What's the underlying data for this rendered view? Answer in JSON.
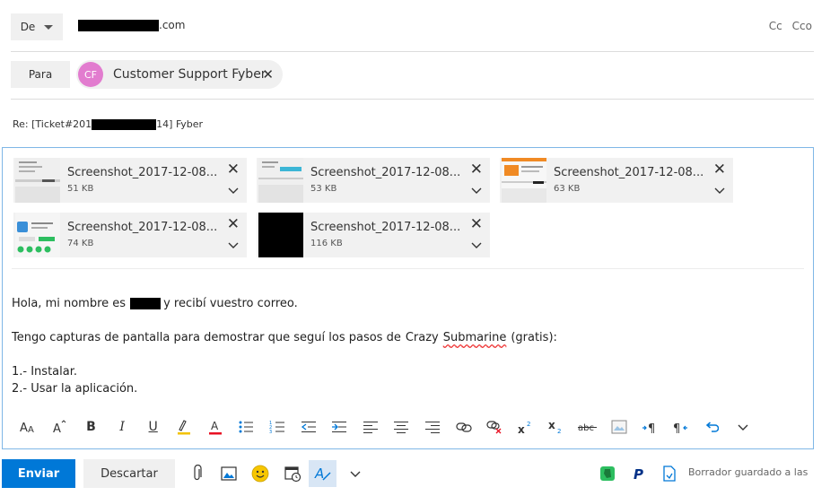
{
  "header": {
    "from_label": "De",
    "from_email_suffix": ".com",
    "cc_label": "Cc",
    "bcc_label": "Cco"
  },
  "recipients": {
    "to_label": "Para",
    "list": [
      {
        "initials": "CF",
        "name": "Customer Support Fyber",
        "avatar_color": "#e27ccf"
      }
    ]
  },
  "subject": {
    "prefix": "Re: [Ticket#201",
    "suffix": "14] Fyber"
  },
  "attachments": [
    {
      "name": "Screenshot_2017-12-08...",
      "size": "51 KB"
    },
    {
      "name": "Screenshot_2017-12-08...",
      "size": "53 KB"
    },
    {
      "name": "Screenshot_2017-12-08...",
      "size": "63 KB"
    },
    {
      "name": "Screenshot_2017-12-08...",
      "size": "74 KB"
    },
    {
      "name": "Screenshot_2017-12-08...",
      "size": "116 KB"
    }
  ],
  "message": {
    "line1_before": "Hola, mi nombre es",
    "line1_after": "y recibí vuestro correo.",
    "line2_before": "Tengo capturas de pantalla para demostrar que seguí los pasos de",
    "line2_app_word1": "Crazy",
    "line2_app_word2": "Submarine",
    "line2_after": "(gratis):",
    "step1": "1.- Instalar.",
    "step2": "2.- Usar la aplicación."
  },
  "format_toolbar": [
    "font-size-icon",
    "font-grow-icon",
    "bold-icon",
    "italic-icon",
    "underline-icon",
    "highlight-icon",
    "font-color-icon",
    "bullets-icon",
    "numbering-icon",
    "outdent-icon",
    "indent-icon",
    "align-left-icon",
    "align-center-icon",
    "align-right-icon",
    "link-icon",
    "unlink-icon",
    "superscript-icon",
    "subscript-icon",
    "strikethrough-icon",
    "picture-inline-icon",
    "ltr-icon",
    "rtl-icon",
    "undo-icon",
    "more-icon"
  ],
  "footer": {
    "send_label": "Enviar",
    "discard_label": "Descartar",
    "draft_status": "Borrador guardado a las"
  },
  "colors": {
    "accent": "#0078d7",
    "compose_border": "#7fb7e6",
    "avatar": "#e27ccf",
    "highlight_bar": "#f3c200",
    "font_color_bar": "#e81123",
    "evernote": "#2dbe60",
    "paypal": "#003087"
  }
}
